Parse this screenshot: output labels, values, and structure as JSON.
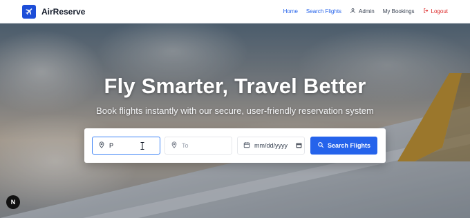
{
  "brand": {
    "name": "AirReserve",
    "logo_icon": "plane-icon",
    "color": "#1d4ed8"
  },
  "nav": {
    "home": "Home",
    "search_flights": "Search Flights",
    "user": "Admin",
    "my_bookings": "My Bookings",
    "logout": "Logout",
    "link_color": "#2563eb",
    "logout_color": "#dc2626"
  },
  "hero": {
    "title": "Fly Smarter, Travel Better",
    "subtitle": "Book flights instantly with our secure, user-friendly reservation system"
  },
  "search": {
    "from_value": "P",
    "to_placeholder": "To",
    "date_placeholder": "mm/dd/yyyy",
    "button_label": "Search Flights",
    "button_color": "#2563eb"
  },
  "badge": {
    "label": "N"
  }
}
